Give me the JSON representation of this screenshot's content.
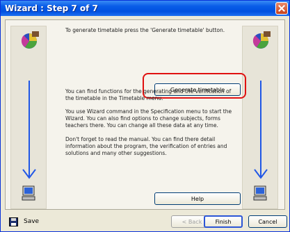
{
  "window": {
    "title": "Wizard : Step 7 of 7"
  },
  "paragraphs": {
    "p1": "To generate timetable press the 'Generate timetable' button.",
    "p2": "You can find functions for the generating and the verification of the timetable in the Timetable menu.",
    "p3": "You use Wizard command in the Specification menu to start the Wizard. You can also find options to change subjects, forms teachers there. You can change all these data at any time.",
    "p4": "Don't forget to read the manual. You can find there detail information about the program, the verification of entries and solutions and many other suggestions."
  },
  "buttons": {
    "generate": "Generate timetable",
    "help": "Help",
    "save": "Save",
    "back": "< Back",
    "finish": "Finish",
    "cancel": "Cancel"
  },
  "colors": {
    "titlebar": "#0050e0",
    "highlight": "#e01010",
    "arrow": "#1f56e6"
  },
  "icons": [
    "logo-icon",
    "down-arrow-icon",
    "computer-icon",
    "floppy-disk-icon",
    "close-icon"
  ]
}
